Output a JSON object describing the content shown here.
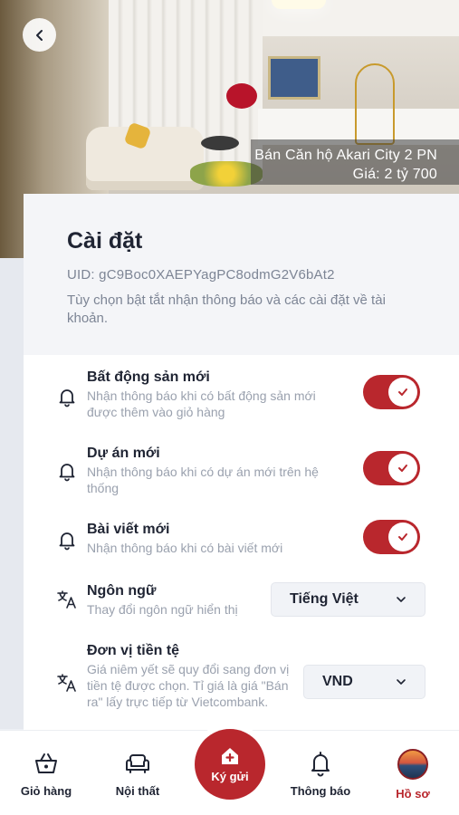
{
  "listing": {
    "title": "Bán Căn hộ Akari City 2 PN",
    "price": "Giá: 2 tỷ 700"
  },
  "settings": {
    "title": "Cài đặt",
    "uid": "UID: gC9Boc0XAEPYagPC8odmG2V6bAt2",
    "description": "Tùy chọn bật tắt nhận thông báo và các cài đặt về tài khoản.",
    "items": [
      {
        "label": "Bất động sản mới",
        "sub": "Nhận thông báo khi có bất động sản mới được thêm vào giỏ hàng",
        "icon": "bell-icon",
        "enabled": true
      },
      {
        "label": "Dự án mới",
        "sub": "Nhận thông báo khi có dự án mới trên hệ thống",
        "icon": "bell-icon",
        "enabled": true
      },
      {
        "label": "Bài viết mới",
        "sub": "Nhận thông báo khi có bài viết mới",
        "icon": "bell-icon",
        "enabled": true
      }
    ],
    "language": {
      "label": "Ngôn ngữ",
      "sub": "Thay đổi ngôn ngữ hiển thị",
      "value": "Tiếng Việt",
      "icon": "translate-icon"
    },
    "currency": {
      "label": "Đơn vị tiền tệ",
      "sub": "Giá niêm yết sẽ quy đổi sang đơn vị tiền tệ được chọn. Tỉ giá là giá \"Bán ra\" lấy trực tiếp từ Vietcombank.",
      "value": "VND",
      "icon": "translate-icon"
    }
  },
  "nav": {
    "cart": "Giỏ hàng",
    "furniture": "Nội thất",
    "consign": "Ký gửi",
    "notifications": "Thông báo",
    "profile": "Hồ sơ"
  },
  "colors": {
    "accent": "#b9272d",
    "text": "#1f2433",
    "muted": "#9aa1ae"
  }
}
